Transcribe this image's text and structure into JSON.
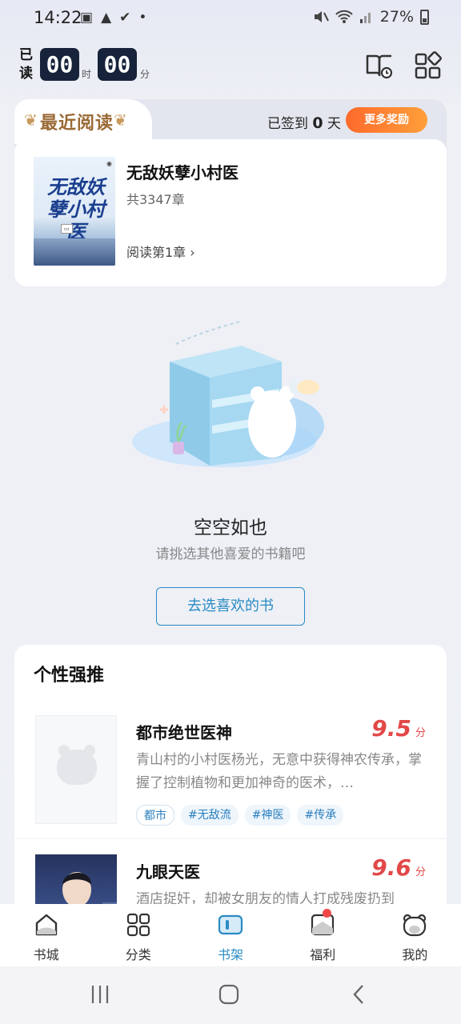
{
  "status": {
    "time": "14:22",
    "battery": "27%"
  },
  "reading_timer": {
    "label": "已读",
    "hours": "00",
    "hours_unit": "时",
    "minutes": "00",
    "minutes_unit": "分"
  },
  "header_icons": [
    "book-clock-icon",
    "apps-grid-icon"
  ],
  "recent": {
    "tab_title": "最近阅读",
    "signin_prefix": "已签到",
    "signin_days": "0",
    "signin_suffix": "天",
    "more_reward": "更多奖励",
    "book": {
      "cover_title": "无敌妖孽小村医",
      "name": "无敌妖孽小村医",
      "chapters": "共3347章",
      "progress": "阅读第1章 ›"
    }
  },
  "empty": {
    "title": "空空如也",
    "subtitle": "请挑选其他喜爱的书籍吧",
    "button": "去选喜欢的书"
  },
  "recommend": {
    "title": "个性强推",
    "items": [
      {
        "name": "都市绝世医神",
        "score": "9.5",
        "score_unit": "分",
        "desc": "青山村的小村医杨光，无意中获得神农传承，掌握了控制植物和更加神奇的医术，…",
        "tags": [
          "都市",
          "#无敌流",
          "#神医",
          "#传承"
        ]
      },
      {
        "name": "九眼天医",
        "score": "9.6",
        "score_unit": "分",
        "desc": "酒店捉奸，却被女朋友的情人打成残废扔到"
      }
    ]
  },
  "bottom_nav": [
    {
      "label": "书城",
      "icon": "home-icon"
    },
    {
      "label": "分类",
      "icon": "category-grid-icon"
    },
    {
      "label": "书架",
      "icon": "bookshelf-icon",
      "active": true
    },
    {
      "label": "福利",
      "icon": "gift-mail-icon",
      "badge": true
    },
    {
      "label": "我的",
      "icon": "bear-profile-icon"
    }
  ],
  "colors": {
    "accent": "#2a8bc4",
    "score_red": "#e24848",
    "reward_orange": "#ff6a2c",
    "timer_dark": "#16233a"
  }
}
